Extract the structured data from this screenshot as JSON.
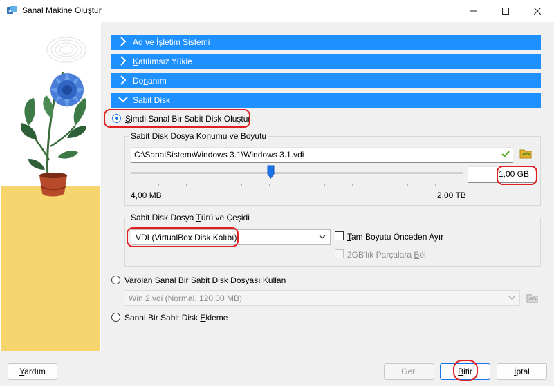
{
  "window": {
    "title": "Sanal Makine Oluştur",
    "controls": {
      "minimize": "—",
      "maximize": "☐",
      "close": "✕"
    }
  },
  "sections": [
    {
      "label_pre": "Ad ve ",
      "label_u": "İ",
      "label_post": "şletim Sistemi",
      "expanded": false
    },
    {
      "label_pre": "",
      "label_u": "K",
      "label_post": "atılımsız Yükle",
      "expanded": false
    },
    {
      "label_pre": "Do",
      "label_u": "n",
      "label_post": "anım",
      "expanded": false
    },
    {
      "label_pre": "Sabit Dis",
      "label_u": "k",
      "label_post": "",
      "expanded": true
    }
  ],
  "disk_options": {
    "create_new": {
      "label_pre": "",
      "label_u": "Ş",
      "label_post": "imdi Sanal Bir Sabit Disk Oluştur",
      "selected": true
    },
    "use_existing": {
      "label_pre": "Varolan Sanal Bir Sabit Disk Dosyası ",
      "label_u": "K",
      "label_post": "ullan",
      "selected": false
    },
    "no_disk": {
      "label_pre": "Sanal Bir Sabit Disk ",
      "label_u": "E",
      "label_post": "kleme",
      "selected": false
    }
  },
  "location_group": {
    "title": "Sabit Disk Dosya Konumu ve Boyutu",
    "path": "C:\\SanalSistem\\Windows 3.1\\Windows 3.1.vdi",
    "size_value": "1,00 GB",
    "slider_min_label": "4,00 MB",
    "slider_max_label": "2,00 TB",
    "slider_position_fraction": 0.42
  },
  "type_group": {
    "title_pre": "Sabit Disk Dosya ",
    "title_u": "T",
    "title_post": "ürü ve Çeşidi",
    "format_selected": "VDI (VirtualBox Disk Kalıbı)",
    "preallocate": {
      "label_pre": "",
      "label_u": "T",
      "label_post": "am Boyutu Önceden Ayır",
      "checked": false
    },
    "split": {
      "label_pre": "2GB'lık Parçalara ",
      "label_u": "B",
      "label_post": "öl",
      "checked": false,
      "enabled": false
    }
  },
  "existing_disk": {
    "selected": "Win 2.vdi (Normal, 120,00 MB)"
  },
  "footer": {
    "help": {
      "pre": "",
      "u": "Y",
      "post": "ardım"
    },
    "back": "Geri",
    "finish": {
      "pre": "",
      "u": "B",
      "post": "itir"
    },
    "cancel": {
      "pre": "",
      "u": "İ",
      "post": "ptal"
    }
  },
  "colors": {
    "section_header": "#1e90ff",
    "highlight_ring": "#e02020",
    "panel_bg": "#f0f0f0",
    "accent": "#1a73e8"
  },
  "icons": [
    "virtualbox-app-icon",
    "chevron-right-icon",
    "chevron-down-icon",
    "checkmark-valid-icon",
    "folder-browse-icon",
    "dropdown-arrow-icon"
  ]
}
